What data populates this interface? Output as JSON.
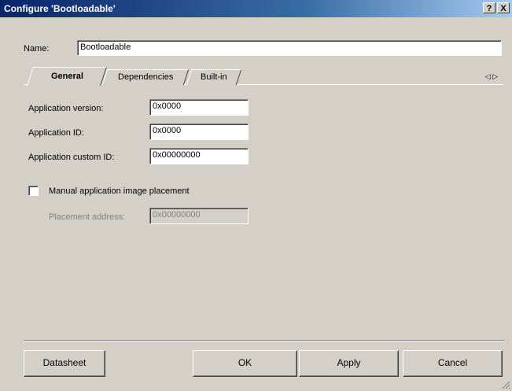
{
  "window": {
    "title": "Configure 'Bootloadable'",
    "help_glyph": "?",
    "close_glyph": "X"
  },
  "name_row": {
    "label": "Name:",
    "value": "Bootloadable"
  },
  "tabs": [
    {
      "label": "General",
      "active": true
    },
    {
      "label": "Dependencies",
      "active": false
    },
    {
      "label": "Built-in",
      "active": false
    }
  ],
  "tab_scroll": {
    "left": "◁",
    "right": "▷"
  },
  "general": {
    "app_version_label": "Application version:",
    "app_version_value": "0x0000",
    "app_id_label": "Application ID:",
    "app_id_value": "0x0000",
    "app_custom_id_label": "Application custom ID:",
    "app_custom_id_value": "0x00000000",
    "manual_placement_label": "Manual application image placement",
    "manual_placement_checked": false,
    "placement_address_label": "Placement address:",
    "placement_address_value": "0x00000000"
  },
  "buttons": {
    "datasheet": "Datasheet",
    "ok": "OK",
    "apply": "Apply",
    "cancel": "Cancel"
  }
}
